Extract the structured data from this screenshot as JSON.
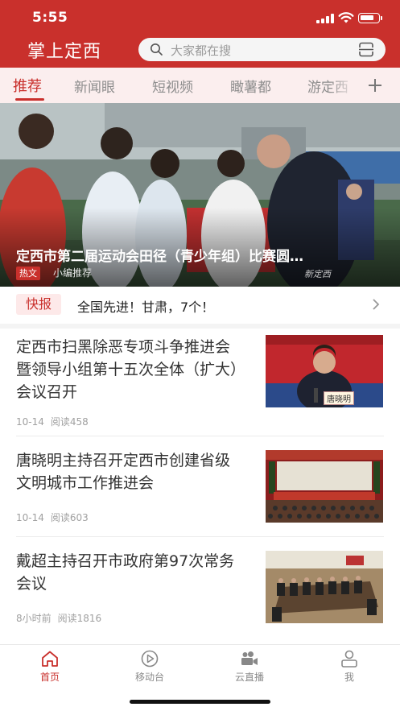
{
  "status_bar": {
    "time": "5:55"
  },
  "header": {
    "app_title": "掌上定西",
    "search_placeholder": "大家都在搜"
  },
  "tabs": [
    {
      "label": "推荐",
      "active": true
    },
    {
      "label": "新闻眼",
      "active": false
    },
    {
      "label": "短视频",
      "active": false
    },
    {
      "label": "瞰薯都",
      "active": false
    },
    {
      "label": "游定西",
      "active": false
    }
  ],
  "hero": {
    "title": "定西市第二届运动会田径（青少年组）比赛圆…",
    "tag": "热文",
    "editor": "小编推荐",
    "watermark": "新定西"
  },
  "flash": {
    "badge": "快报",
    "text": "全国先进！甘肃，7个！"
  },
  "news": [
    {
      "title": "定西市扫黑除恶专项斗争推进会暨领导小组第十五次全体（扩大）会议召开",
      "date": "10-14",
      "reads": "阅读458",
      "thumb_caption": "唐晓明"
    },
    {
      "title": "唐晓明主持召开定西市创建省级文明城市工作推进会",
      "date": "10-14",
      "reads": "阅读603"
    },
    {
      "title": "戴超主持召开市政府第97次常务会议",
      "date": "8小时前",
      "reads": "阅读1816"
    }
  ],
  "bottom_nav": [
    {
      "label": "首页",
      "icon": "home-icon",
      "active": true
    },
    {
      "label": "移动台",
      "icon": "play-icon",
      "active": false
    },
    {
      "label": "云直播",
      "icon": "video-camera-icon",
      "active": false
    },
    {
      "label": "我",
      "icon": "user-icon",
      "active": false
    }
  ],
  "colors": {
    "brand": "#c9302c",
    "tab_bar_bg": "#fbeeee",
    "flash_badge_bg": "#fde9e9"
  }
}
